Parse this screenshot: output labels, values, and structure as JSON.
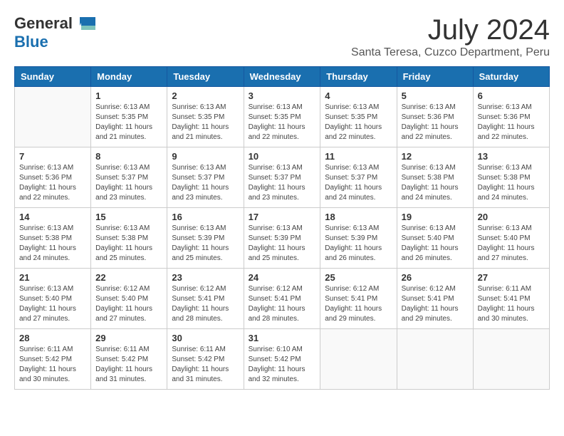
{
  "header": {
    "logo_general": "General",
    "logo_blue": "Blue",
    "month_title": "July 2024",
    "location": "Santa Teresa, Cuzco Department, Peru"
  },
  "days_of_week": [
    "Sunday",
    "Monday",
    "Tuesday",
    "Wednesday",
    "Thursday",
    "Friday",
    "Saturday"
  ],
  "weeks": [
    [
      {
        "day": "",
        "info": ""
      },
      {
        "day": "1",
        "info": "Sunrise: 6:13 AM\nSunset: 5:35 PM\nDaylight: 11 hours\nand 21 minutes."
      },
      {
        "day": "2",
        "info": "Sunrise: 6:13 AM\nSunset: 5:35 PM\nDaylight: 11 hours\nand 21 minutes."
      },
      {
        "day": "3",
        "info": "Sunrise: 6:13 AM\nSunset: 5:35 PM\nDaylight: 11 hours\nand 22 minutes."
      },
      {
        "day": "4",
        "info": "Sunrise: 6:13 AM\nSunset: 5:35 PM\nDaylight: 11 hours\nand 22 minutes."
      },
      {
        "day": "5",
        "info": "Sunrise: 6:13 AM\nSunset: 5:36 PM\nDaylight: 11 hours\nand 22 minutes."
      },
      {
        "day": "6",
        "info": "Sunrise: 6:13 AM\nSunset: 5:36 PM\nDaylight: 11 hours\nand 22 minutes."
      }
    ],
    [
      {
        "day": "7",
        "info": "Sunrise: 6:13 AM\nSunset: 5:36 PM\nDaylight: 11 hours\nand 22 minutes."
      },
      {
        "day": "8",
        "info": "Sunrise: 6:13 AM\nSunset: 5:37 PM\nDaylight: 11 hours\nand 23 minutes."
      },
      {
        "day": "9",
        "info": "Sunrise: 6:13 AM\nSunset: 5:37 PM\nDaylight: 11 hours\nand 23 minutes."
      },
      {
        "day": "10",
        "info": "Sunrise: 6:13 AM\nSunset: 5:37 PM\nDaylight: 11 hours\nand 23 minutes."
      },
      {
        "day": "11",
        "info": "Sunrise: 6:13 AM\nSunset: 5:37 PM\nDaylight: 11 hours\nand 24 minutes."
      },
      {
        "day": "12",
        "info": "Sunrise: 6:13 AM\nSunset: 5:38 PM\nDaylight: 11 hours\nand 24 minutes."
      },
      {
        "day": "13",
        "info": "Sunrise: 6:13 AM\nSunset: 5:38 PM\nDaylight: 11 hours\nand 24 minutes."
      }
    ],
    [
      {
        "day": "14",
        "info": "Sunrise: 6:13 AM\nSunset: 5:38 PM\nDaylight: 11 hours\nand 24 minutes."
      },
      {
        "day": "15",
        "info": "Sunrise: 6:13 AM\nSunset: 5:38 PM\nDaylight: 11 hours\nand 25 minutes."
      },
      {
        "day": "16",
        "info": "Sunrise: 6:13 AM\nSunset: 5:39 PM\nDaylight: 11 hours\nand 25 minutes."
      },
      {
        "day": "17",
        "info": "Sunrise: 6:13 AM\nSunset: 5:39 PM\nDaylight: 11 hours\nand 25 minutes."
      },
      {
        "day": "18",
        "info": "Sunrise: 6:13 AM\nSunset: 5:39 PM\nDaylight: 11 hours\nand 26 minutes."
      },
      {
        "day": "19",
        "info": "Sunrise: 6:13 AM\nSunset: 5:40 PM\nDaylight: 11 hours\nand 26 minutes."
      },
      {
        "day": "20",
        "info": "Sunrise: 6:13 AM\nSunset: 5:40 PM\nDaylight: 11 hours\nand 27 minutes."
      }
    ],
    [
      {
        "day": "21",
        "info": "Sunrise: 6:13 AM\nSunset: 5:40 PM\nDaylight: 11 hours\nand 27 minutes."
      },
      {
        "day": "22",
        "info": "Sunrise: 6:12 AM\nSunset: 5:40 PM\nDaylight: 11 hours\nand 27 minutes."
      },
      {
        "day": "23",
        "info": "Sunrise: 6:12 AM\nSunset: 5:41 PM\nDaylight: 11 hours\nand 28 minutes."
      },
      {
        "day": "24",
        "info": "Sunrise: 6:12 AM\nSunset: 5:41 PM\nDaylight: 11 hours\nand 28 minutes."
      },
      {
        "day": "25",
        "info": "Sunrise: 6:12 AM\nSunset: 5:41 PM\nDaylight: 11 hours\nand 29 minutes."
      },
      {
        "day": "26",
        "info": "Sunrise: 6:12 AM\nSunset: 5:41 PM\nDaylight: 11 hours\nand 29 minutes."
      },
      {
        "day": "27",
        "info": "Sunrise: 6:11 AM\nSunset: 5:41 PM\nDaylight: 11 hours\nand 30 minutes."
      }
    ],
    [
      {
        "day": "28",
        "info": "Sunrise: 6:11 AM\nSunset: 5:42 PM\nDaylight: 11 hours\nand 30 minutes."
      },
      {
        "day": "29",
        "info": "Sunrise: 6:11 AM\nSunset: 5:42 PM\nDaylight: 11 hours\nand 31 minutes."
      },
      {
        "day": "30",
        "info": "Sunrise: 6:11 AM\nSunset: 5:42 PM\nDaylight: 11 hours\nand 31 minutes."
      },
      {
        "day": "31",
        "info": "Sunrise: 6:10 AM\nSunset: 5:42 PM\nDaylight: 11 hours\nand 32 minutes."
      },
      {
        "day": "",
        "info": ""
      },
      {
        "day": "",
        "info": ""
      },
      {
        "day": "",
        "info": ""
      }
    ]
  ]
}
